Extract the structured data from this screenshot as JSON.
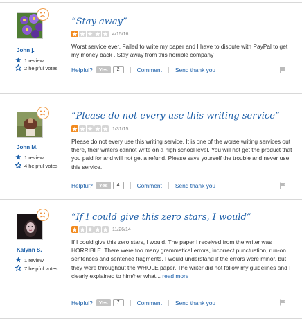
{
  "reviews": [
    {
      "user": {
        "name": "John j.",
        "reviews": "1 review",
        "helpful": "2 helpful votes"
      },
      "title": "“Stay away”",
      "stars_on": 1,
      "stars_total": 5,
      "date": "4/15/16",
      "body": "Worst service ever. Failed to write my paper and I have to dispute with PayPal to get my money back . Stay away from this horrible company",
      "read_more": "",
      "actions": {
        "helpful": "Helpful?",
        "yes": "Yes",
        "count": "2",
        "comment": "Comment",
        "thank": "Send thank you"
      }
    },
    {
      "user": {
        "name": "John M.",
        "reviews": "1 review",
        "helpful": "4 helpful votes"
      },
      "title": "“Please do not every use this writing service”",
      "stars_on": 1,
      "stars_total": 5,
      "date": "1/31/15",
      "body": "Please do not every use this writing service. It is one of the worse writing services out there, their writers cannot write on a high school level. You will not get the product that you paid for and will not get a refund. Please save yourself the trouble and never use this service.",
      "read_more": "",
      "actions": {
        "helpful": "Helpful?",
        "yes": "Yes",
        "count": "4",
        "comment": "Comment",
        "thank": "Send thank you"
      }
    },
    {
      "user": {
        "name": "Kalynn S.",
        "reviews": "1 review",
        "helpful": "7 helpful votes"
      },
      "title": "“If I could give this zero stars, I would”",
      "stars_on": 1,
      "stars_total": 5,
      "date": "11/26/14",
      "body": "If I could give this zero stars, I would. The paper I received from the writer was HORRIBLE. There were too many grammatical errors, incorrect punctuation, run-on sentences and sentence fragments. I would understand if the errors were minor, but they were throughout the WHOLE paper. The writer did not follow my guidelines and I clearly explained to him/her what... ",
      "read_more": "read more",
      "actions": {
        "helpful": "Helpful?",
        "yes": "Yes",
        "count": "7",
        "comment": "Comment",
        "thank": "Send thank you"
      }
    }
  ],
  "colors": {
    "link": "#1a5ea8",
    "star_on": "#f28a1e",
    "star_off": "#d6d6d6",
    "badge": "#f0a050"
  },
  "icons": [
    "sad-face-icon",
    "review-count-icon",
    "helpful-star-icon",
    "star-icon",
    "flag-icon"
  ]
}
